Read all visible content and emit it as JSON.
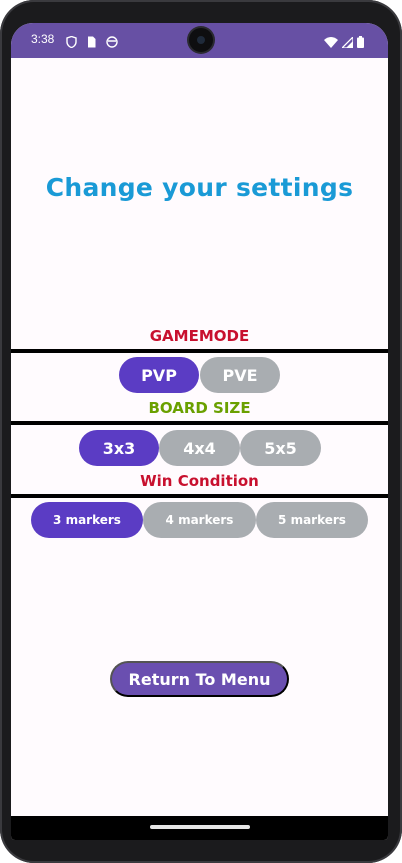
{
  "status_bar": {
    "time": "3:38",
    "color": "#6750a4"
  },
  "page": {
    "title": "Change your settings"
  },
  "gamemode": {
    "label": "GAMEMODE",
    "label_color": "#c8102e",
    "options": [
      "PVP",
      "PVE"
    ],
    "selected": "PVP"
  },
  "board_size": {
    "label": "BOARD SIZE",
    "label_color": "#6aa000",
    "options": [
      "3x3",
      "4x4",
      "5x5"
    ],
    "selected": "3x3"
  },
  "win_condition": {
    "label": "Win Condition",
    "label_color": "#c8102e",
    "options": [
      "3 markers",
      "4 markers",
      "5 markers"
    ],
    "selected": "3 markers"
  },
  "return_button": {
    "label": "Return To Menu"
  },
  "colors": {
    "active": "#5b3cc4",
    "inactive": "#a9adb1",
    "title": "#1a9ad6"
  }
}
